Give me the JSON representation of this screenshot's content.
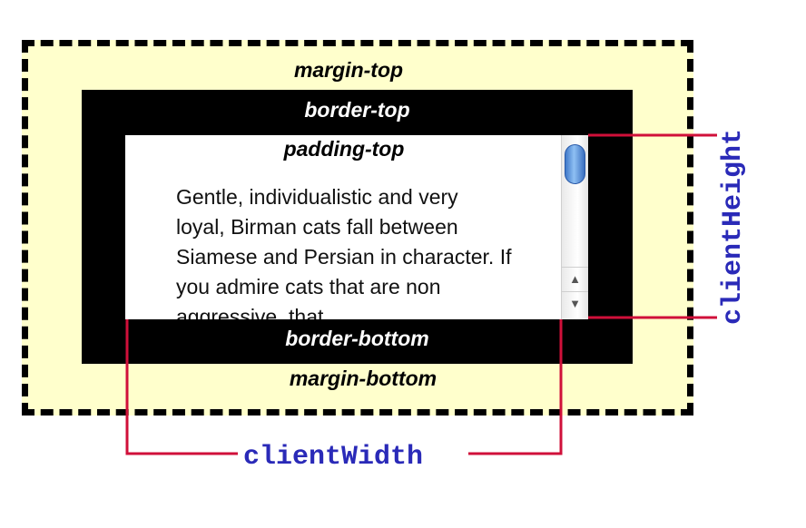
{
  "labels": {
    "margin_top": "margin-top",
    "border_top": "border-top",
    "padding_top": "padding-top",
    "border_bottom": "border-bottom",
    "margin_bottom": "margin-bottom"
  },
  "content": {
    "text": "Gentle, individualistic and very loyal, Birman cats fall between Siamese and Persian in character. If you admire cats that are non aggressive, that"
  },
  "scrollbar": {
    "up_arrow": "▲",
    "down_arrow": "▼"
  },
  "callouts": {
    "client_width": "clientWidth",
    "client_height": "clientHeight"
  },
  "colors": {
    "margin_fill": "#ffffcc",
    "border_fill": "#000000",
    "callout_line": "#d0103a",
    "callout_text": "#2a2ab8"
  }
}
